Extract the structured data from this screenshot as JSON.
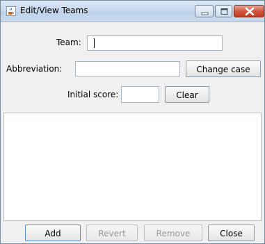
{
  "window": {
    "title": "Edit/View Teams",
    "icon": "java-cup-icon"
  },
  "form": {
    "team_label": "Team:",
    "team_value": "",
    "abbreviation_label": "Abbreviation:",
    "abbreviation_value": "",
    "change_case_label": "Change case",
    "initial_score_label": "Initial score:",
    "initial_score_value": "",
    "clear_label": "Clear"
  },
  "teams_list": {
    "items": []
  },
  "buttons": {
    "add": "Add",
    "revert": "Revert",
    "remove": "Remove",
    "close": "Close"
  },
  "colors": {
    "close_button": "#c23b22",
    "focus_border": "#5a8fd0",
    "disabled_text": "#9a9a9a"
  }
}
